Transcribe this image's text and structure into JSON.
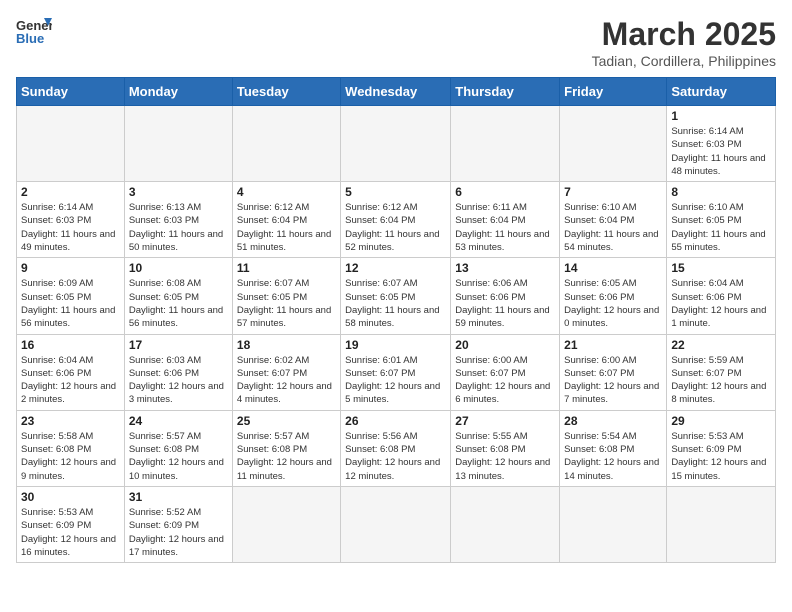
{
  "header": {
    "logo_text_general": "General",
    "logo_text_blue": "Blue",
    "month_year": "March 2025",
    "location": "Tadian, Cordillera, Philippines"
  },
  "days_of_week": [
    "Sunday",
    "Monday",
    "Tuesday",
    "Wednesday",
    "Thursday",
    "Friday",
    "Saturday"
  ],
  "weeks": [
    [
      {
        "day": "",
        "info": ""
      },
      {
        "day": "",
        "info": ""
      },
      {
        "day": "",
        "info": ""
      },
      {
        "day": "",
        "info": ""
      },
      {
        "day": "",
        "info": ""
      },
      {
        "day": "",
        "info": ""
      },
      {
        "day": "1",
        "info": "Sunrise: 6:14 AM\nSunset: 6:03 PM\nDaylight: 11 hours and 48 minutes."
      }
    ],
    [
      {
        "day": "2",
        "info": "Sunrise: 6:14 AM\nSunset: 6:03 PM\nDaylight: 11 hours and 49 minutes."
      },
      {
        "day": "3",
        "info": "Sunrise: 6:13 AM\nSunset: 6:03 PM\nDaylight: 11 hours and 50 minutes."
      },
      {
        "day": "4",
        "info": "Sunrise: 6:12 AM\nSunset: 6:04 PM\nDaylight: 11 hours and 51 minutes."
      },
      {
        "day": "5",
        "info": "Sunrise: 6:12 AM\nSunset: 6:04 PM\nDaylight: 11 hours and 52 minutes."
      },
      {
        "day": "6",
        "info": "Sunrise: 6:11 AM\nSunset: 6:04 PM\nDaylight: 11 hours and 53 minutes."
      },
      {
        "day": "7",
        "info": "Sunrise: 6:10 AM\nSunset: 6:04 PM\nDaylight: 11 hours and 54 minutes."
      },
      {
        "day": "8",
        "info": "Sunrise: 6:10 AM\nSunset: 6:05 PM\nDaylight: 11 hours and 55 minutes."
      }
    ],
    [
      {
        "day": "9",
        "info": "Sunrise: 6:09 AM\nSunset: 6:05 PM\nDaylight: 11 hours and 56 minutes."
      },
      {
        "day": "10",
        "info": "Sunrise: 6:08 AM\nSunset: 6:05 PM\nDaylight: 11 hours and 56 minutes."
      },
      {
        "day": "11",
        "info": "Sunrise: 6:07 AM\nSunset: 6:05 PM\nDaylight: 11 hours and 57 minutes."
      },
      {
        "day": "12",
        "info": "Sunrise: 6:07 AM\nSunset: 6:05 PM\nDaylight: 11 hours and 58 minutes."
      },
      {
        "day": "13",
        "info": "Sunrise: 6:06 AM\nSunset: 6:06 PM\nDaylight: 11 hours and 59 minutes."
      },
      {
        "day": "14",
        "info": "Sunrise: 6:05 AM\nSunset: 6:06 PM\nDaylight: 12 hours and 0 minutes."
      },
      {
        "day": "15",
        "info": "Sunrise: 6:04 AM\nSunset: 6:06 PM\nDaylight: 12 hours and 1 minute."
      }
    ],
    [
      {
        "day": "16",
        "info": "Sunrise: 6:04 AM\nSunset: 6:06 PM\nDaylight: 12 hours and 2 minutes."
      },
      {
        "day": "17",
        "info": "Sunrise: 6:03 AM\nSunset: 6:06 PM\nDaylight: 12 hours and 3 minutes."
      },
      {
        "day": "18",
        "info": "Sunrise: 6:02 AM\nSunset: 6:07 PM\nDaylight: 12 hours and 4 minutes."
      },
      {
        "day": "19",
        "info": "Sunrise: 6:01 AM\nSunset: 6:07 PM\nDaylight: 12 hours and 5 minutes."
      },
      {
        "day": "20",
        "info": "Sunrise: 6:00 AM\nSunset: 6:07 PM\nDaylight: 12 hours and 6 minutes."
      },
      {
        "day": "21",
        "info": "Sunrise: 6:00 AM\nSunset: 6:07 PM\nDaylight: 12 hours and 7 minutes."
      },
      {
        "day": "22",
        "info": "Sunrise: 5:59 AM\nSunset: 6:07 PM\nDaylight: 12 hours and 8 minutes."
      }
    ],
    [
      {
        "day": "23",
        "info": "Sunrise: 5:58 AM\nSunset: 6:08 PM\nDaylight: 12 hours and 9 minutes."
      },
      {
        "day": "24",
        "info": "Sunrise: 5:57 AM\nSunset: 6:08 PM\nDaylight: 12 hours and 10 minutes."
      },
      {
        "day": "25",
        "info": "Sunrise: 5:57 AM\nSunset: 6:08 PM\nDaylight: 12 hours and 11 minutes."
      },
      {
        "day": "26",
        "info": "Sunrise: 5:56 AM\nSunset: 6:08 PM\nDaylight: 12 hours and 12 minutes."
      },
      {
        "day": "27",
        "info": "Sunrise: 5:55 AM\nSunset: 6:08 PM\nDaylight: 12 hours and 13 minutes."
      },
      {
        "day": "28",
        "info": "Sunrise: 5:54 AM\nSunset: 6:08 PM\nDaylight: 12 hours and 14 minutes."
      },
      {
        "day": "29",
        "info": "Sunrise: 5:53 AM\nSunset: 6:09 PM\nDaylight: 12 hours and 15 minutes."
      }
    ],
    [
      {
        "day": "30",
        "info": "Sunrise: 5:53 AM\nSunset: 6:09 PM\nDaylight: 12 hours and 16 minutes."
      },
      {
        "day": "31",
        "info": "Sunrise: 5:52 AM\nSunset: 6:09 PM\nDaylight: 12 hours and 17 minutes."
      },
      {
        "day": "",
        "info": ""
      },
      {
        "day": "",
        "info": ""
      },
      {
        "day": "",
        "info": ""
      },
      {
        "day": "",
        "info": ""
      },
      {
        "day": "",
        "info": ""
      }
    ]
  ]
}
